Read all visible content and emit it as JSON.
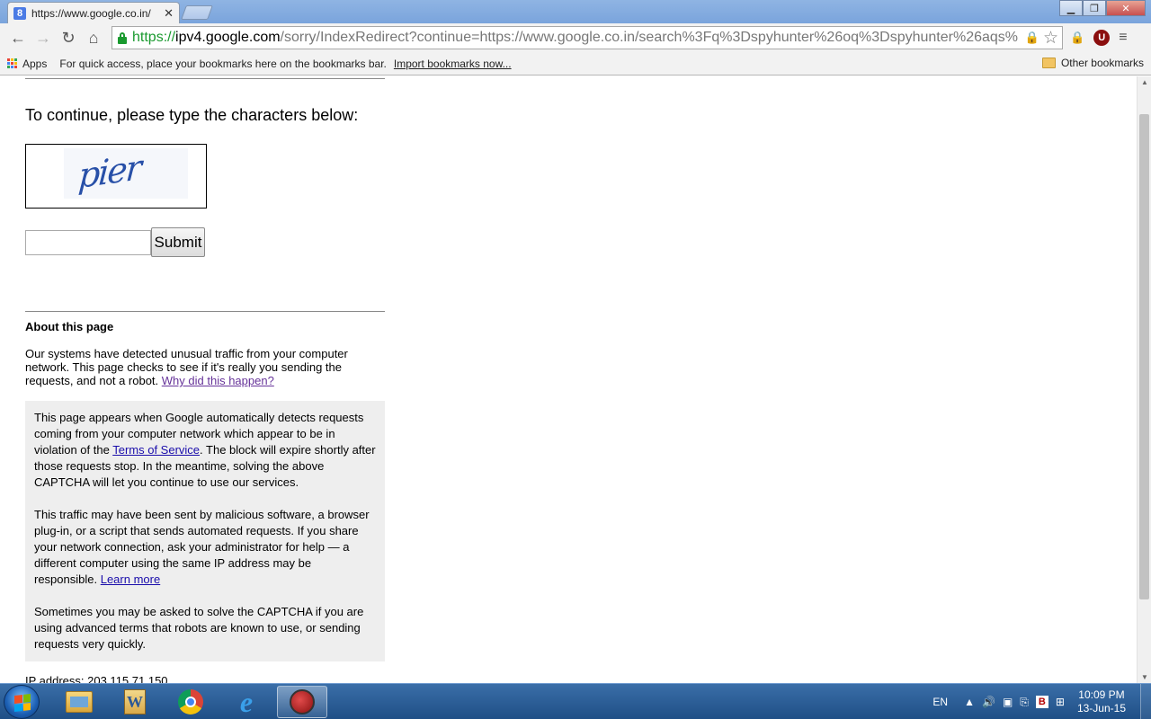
{
  "browser": {
    "tab_title": "https://www.google.co.in/",
    "favicon_letter": "8",
    "url_scheme": "https://",
    "url_host": "ipv4.google.com",
    "url_rest": "/sorry/IndexRedirect?continue=https://www.google.co.in/search%3Fq%3Dspyhunter%26oq%3Dspyhunter%26aqs%",
    "ext_ublock_letter": "U",
    "bookmarks": {
      "apps_label": "Apps",
      "hint": "For quick access, place your bookmarks here on the bookmarks bar.",
      "import_link": "Import bookmarks now...",
      "other": "Other bookmarks"
    }
  },
  "page": {
    "prompt": "To continue, please type the characters below:",
    "captcha_word": "pier",
    "input_value": "",
    "submit_label": "Submit",
    "about_title": "About this page",
    "about_text": "Our systems have detected unusual traffic from your computer network. This page checks to see if it's really you sending the requests, and not a robot. ",
    "about_link": "Why did this happen?",
    "info_p1_a": "This page appears when Google automatically detects requests coming from your computer network which appear to be in violation of the ",
    "info_p1_link": "Terms of Service",
    "info_p1_b": ". The block will expire shortly after those requests stop. In the meantime, solving the above CAPTCHA will let you continue to use our services.",
    "info_p2_a": "This traffic may have been sent by malicious software, a browser plug-in, or a script that sends automated requests. If you share your network connection, ask your administrator for help — a different computer using the same IP address may be responsible. ",
    "info_p2_link": "Learn more",
    "info_p3": "Sometimes you may be asked to solve the CAPTCHA if you are using advanced terms that robots are known to use, or sending requests very quickly.",
    "ip_label": "IP address: 203.115.71.150"
  },
  "taskbar": {
    "word_letter": "W",
    "ie_letter": "e",
    "lang": "EN",
    "tray_b_letter": "B",
    "time": "10:09 PM",
    "date": "13-Jun-15"
  },
  "icons": [
    "back-icon",
    "forward-icon",
    "reload-icon",
    "home-icon",
    "lock-icon",
    "star-icon",
    "chrome-menu-icon",
    "apps-icon",
    "folder-icon",
    "windows-flag-icon",
    "explorer-icon",
    "word-icon",
    "chrome-icon",
    "ie-icon"
  ],
  "colors": {
    "url_green": "#1a9a2f",
    "link_blue": "#1a0dab",
    "visited_link": "#663399",
    "infobox_bg": "#eeeeee",
    "taskbar": "#245a96"
  }
}
